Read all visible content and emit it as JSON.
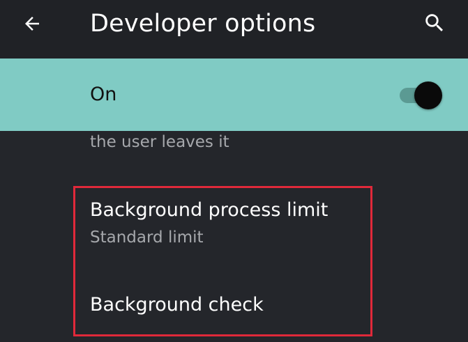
{
  "toolbar": {
    "title": "Developer options",
    "back_icon": "arrow-left-icon",
    "search_icon": "search-icon"
  },
  "master_switch": {
    "label": "On",
    "state": "on"
  },
  "cut_item": {
    "summary_tail": "the user leaves it"
  },
  "items": [
    {
      "title": "Background process limit",
      "summary": "Standard limit"
    },
    {
      "title": "Background check"
    }
  ],
  "colors": {
    "background": "#24262b",
    "toolbar": "#202226",
    "switch_bar": "#80cbc4",
    "toggle_thumb": "#0a0a0a",
    "highlight": "#e0293a"
  }
}
